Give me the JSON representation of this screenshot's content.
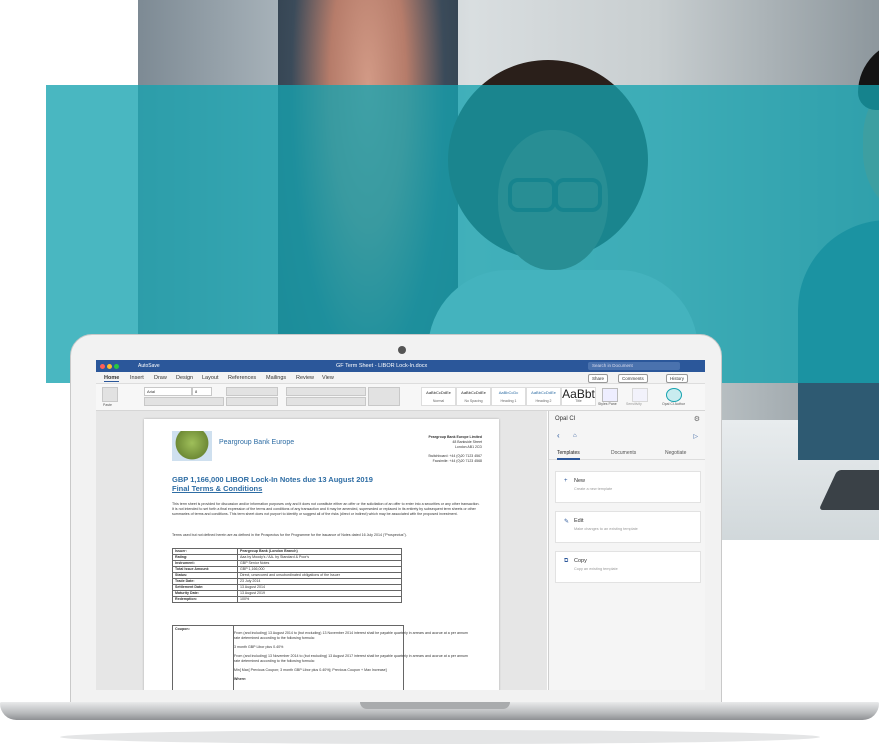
{
  "window": {
    "autosave_label": "AutoSave",
    "title": "GF Term Sheet - LIBOR Lock-In.docx",
    "search_placeholder": "Search in Document"
  },
  "menu": {
    "tabs": [
      "Home",
      "Insert",
      "Draw",
      "Design",
      "Layout",
      "References",
      "Mailings",
      "Review",
      "View"
    ],
    "share": "Share",
    "comments": "Comments",
    "history": "History"
  },
  "ribbon": {
    "paste": "Paste",
    "font_name": "Arial",
    "font_size": "8",
    "styles": [
      {
        "preview": "AaBbCcDdEe",
        "name": "Normal"
      },
      {
        "preview": "AaBbCcDdEe",
        "name": "No Spacing"
      },
      {
        "preview": "AaBbCcDc",
        "name": "Heading 1"
      },
      {
        "preview": "AaBbCcDdEe",
        "name": "Heading 2"
      },
      {
        "preview": "AaBbt",
        "name": "Title"
      }
    ],
    "styles_pane": "Styles Pane",
    "sensitivity": "Sensitivity",
    "opal_author": "Opal CI Author"
  },
  "document": {
    "bank_name": "Peargroup Bank Europe",
    "address_lines": [
      "Peargroup Bank Europe Limited",
      "48 Bankside Street",
      "London AB1 2CD",
      "Switchboard: +44 (0)20 7123 4567",
      "Facsimile: +44 (0)20 7123 4568"
    ],
    "heading_1": "GBP 1,166,000 LIBOR Lock-In Notes due 13 August 2019",
    "heading_2": "Final Terms & Conditions",
    "intro": "This term sheet is provided for discussion and/or information purposes only and it does not constitute either an offer or the solicitation of an offer to enter into a securities or any other transaction. It is not intended to set forth a final expression of the terms and conditions of any transaction and it may be amended, superseded or replaced in its entirety by subsequent term sheets or other summaries of terms and conditions. This term sheet does not purport to identify or suggest all of the risks (direct or indirect) which may be associated with the proposed investment.",
    "defined_terms": "Terms used but not defined herein are as defined in the Prospectus for the Programme for the issuance of Notes dated 16 July 2014 (\"Prospectus\").",
    "terms": [
      [
        "Issuer:",
        "Peargroup Bank (London Branch)"
      ],
      [
        "Rating:",
        "Aaa by Moody's / AA- by Standard & Poor's"
      ],
      [
        "Instrument:",
        "GBP Senior Notes"
      ],
      [
        "Total Issue Amount:",
        "GBP 1,166,000"
      ],
      [
        "Status:",
        "Direct, unsecured and unsubordinated obligations of the Issuer"
      ],
      [
        "Trade Date:",
        "23 July 2014"
      ],
      [
        "Settlement Date:",
        "13 August 2014"
      ],
      [
        "Maturity Date:",
        "13 August 2019"
      ],
      [
        "Redemption:",
        "100%"
      ]
    ],
    "coupon_label": "Coupon:",
    "coupon_text": [
      "From (and including) 13 August 2014 to (but excluding) 13 November 2014 interest shall be payable quarterly in arrears and accrue at a per annum rate determined according to the following formula:",
      "3 month GBP Libor plus 0.40%",
      "From (and including) 13 November 2014 to (but excluding) 13 August 2017 interest shall be payable quarterly in arrears and accrue at a per annum rate determined according to the following formula:",
      "Min[ Max[ Previous Coupon; 3 month GBP Libor plus 0.40%]; Previous Coupon + Max Increase]",
      "Where:"
    ]
  },
  "sidepane": {
    "title": "Opal CI",
    "tabs": [
      "Templates",
      "Documents",
      "Negotiate"
    ],
    "cards": [
      {
        "icon": "+",
        "title": "New",
        "subtitle": "Create a new template"
      },
      {
        "icon": "✎",
        "title": "Edit",
        "subtitle": "Make changes to an existing template"
      },
      {
        "icon": "⧉",
        "title": "Copy",
        "subtitle": "Copy an existing template"
      }
    ]
  },
  "colors": {
    "word_blue": "#2b579a",
    "teal_band": "#16a3b0",
    "link_blue": "#2e6da4"
  }
}
